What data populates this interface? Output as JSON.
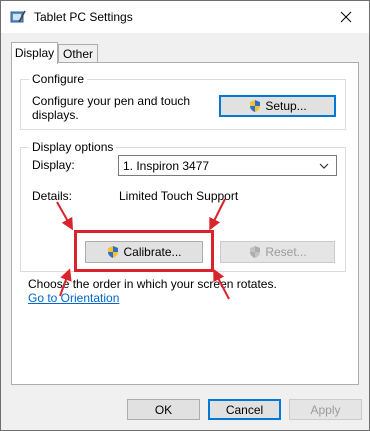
{
  "window": {
    "title": "Tablet PC Settings",
    "close_icon": "close-icon"
  },
  "tabs": [
    {
      "label": "Display",
      "active": true
    },
    {
      "label": "Other",
      "active": false
    }
  ],
  "configure": {
    "group_label": "Configure",
    "text": "Configure your pen and touch displays.",
    "setup_button": "Setup..."
  },
  "display_options": {
    "group_label": "Display options",
    "display_label": "Display:",
    "display_value": "1. Inspiron 3477",
    "details_label": "Details:",
    "details_value": "Limited Touch Support",
    "calibrate_button": "Calibrate...",
    "reset_button": "Reset..."
  },
  "orientation": {
    "text": "Choose the order in which your screen rotates.",
    "link": "Go to Orientation"
  },
  "footer": {
    "ok": "OK",
    "cancel": "Cancel",
    "apply": "Apply"
  },
  "colors": {
    "annotation": "#d9232d",
    "accent": "#0078d7",
    "link": "#0066cc"
  }
}
